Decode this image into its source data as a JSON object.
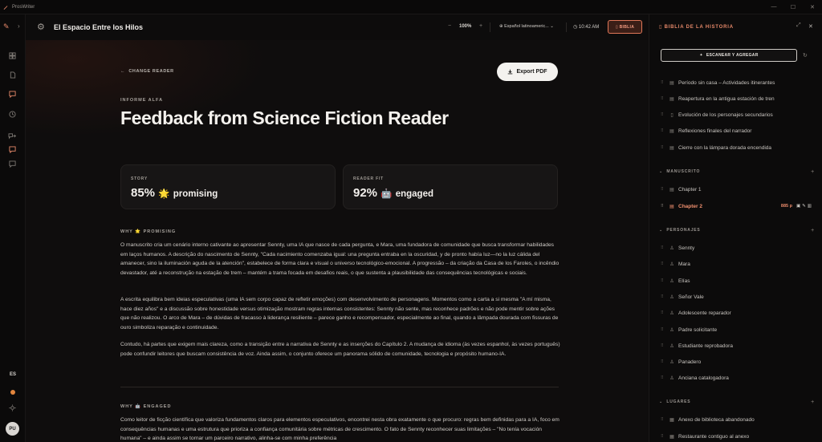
{
  "titlebar": {
    "app_name": "ProsWriter",
    "minimize": "—",
    "maximize": "☐",
    "close": "✕"
  },
  "header": {
    "project_title": "El Espacio Entre los Hilos",
    "zoom_minus": "−",
    "zoom": "100%",
    "zoom_plus": "+",
    "language": "Español latinoameric...",
    "time": "10:42 AM",
    "bible_button": "BIBLIA"
  },
  "rail": {
    "language": "ES",
    "avatar": "PU"
  },
  "main": {
    "back_label": "CHANGE READER",
    "export_label": "Export PDF",
    "kicker": "INFORME ALFA",
    "title": "Feedback from Science Fiction Reader",
    "cards": [
      {
        "label": "STORY",
        "percent": "85%",
        "emoji": "🌟",
        "word": "promising"
      },
      {
        "label": "READER FIT",
        "percent": "92%",
        "emoji": "🤖",
        "word": "engaged"
      }
    ],
    "section1_title": "WHY 🌟 PROMISING",
    "paragraphs": [
      "O manuscrito cria um cenário interno cativante ao apresentar Sennty, uma IA que nasce de cada pergunta, e Mara, uma fundadora de comunidade que busca transformar habilidades em laços humanos. A descrição do nascimento de Sennty, \"Cada nacimiento comenzaba igual: una pregunta entraba en la oscuridad, y de pronto había luz—no la luz cálida del amanecer, sino la iluminación aguda de la atención\", estabelece de forma clara e visual o universo tecnológico-emocional. A progressão – da criação da Casa de los Faroles, o incêndio devastador, até a reconstrução na estação de trem – mantém a trama focada em desafios reais, o que sustenta a plausibilidade das consequências tecnológicas e sociais.",
      "A escrita equilibra bem ideias especulativas (uma IA sem corpo capaz de refletir emoções) com desenvolvimento de personagens. Momentos como a carta a si mesma \"A mí misma, hace diez años\" e a discussão sobre honestidade versus otimização mostram regras internas consistentes: Sennty não sente, mas reconhece padrões e não pode mentir sobre ações que não realizou. O arco de Mara – de dúvidas de fracasso à liderança resiliente – parece ganho e recompensador, especialmente ao final, quando a lâmpada dourada com fissuras de ouro simboliza reparação e continuidade.",
      "Contudo, há partes que exigem mais clareza, como a transição entre a narrativa de Sennty e as inserções do Capítulo 2. A mudança de idioma (às vezes espanhol, às vezes português) pode confundir leitores que buscam consistência de voz. Ainda assim, o conjunto oferece um panorama sólido de comunidade, tecnologia e propósito humano-IA."
    ],
    "section2_title": "WHY 🤖 ENGAGED",
    "paragraph_engaged": "Como leitor de ficção científica que valoriza fundamentos claros para elementos especulativos, encontrei nesta obra exatamente o que procuro: regras bem definidas para a IA, foco em consequências humanas e uma estrutura que prioriza a confiança comunitária sobre métricas de crescimento. O fato de Sennty reconhecer suas limitações – \"No tenía vocación humana\" – e ainda assim se tornar um parceiro narrativo, alinha-se com minha preferência"
  },
  "panel": {
    "title": "BIBLIA DE LA HISTORIA",
    "scan_label": "ESCANEAR Y AGREGAR",
    "notes": [
      "Período sin casa – Actividades itinerantes",
      "Reapertura en la antigua estación de tren",
      "Evolución de los personajes secundarios",
      "Reflexiones finales del narrador",
      "Cierre con la lámpara dorada encendida"
    ],
    "manuscript_label": "MANUSCRITO",
    "chapters": [
      {
        "label": "Chapter 1"
      },
      {
        "label": "Chapter 2",
        "meta": "885 p"
      }
    ],
    "characters_label": "PERSONAJES",
    "characters": [
      "Sennty",
      "Mara",
      "Elías",
      "Señor Vale",
      "Adolescente reparador",
      "Padre solicitante",
      "Estudiante reprobadora",
      "Panadero",
      "Anciana catalogadora"
    ],
    "places_label": "LUGARES",
    "places": [
      "Anexo de biblioteca abandonado",
      "Restaurante contiguo al anexo"
    ]
  },
  "colors": {
    "accent": "#e7896a",
    "background": "#0f0d0d",
    "panel": "#0c0b0b"
  }
}
